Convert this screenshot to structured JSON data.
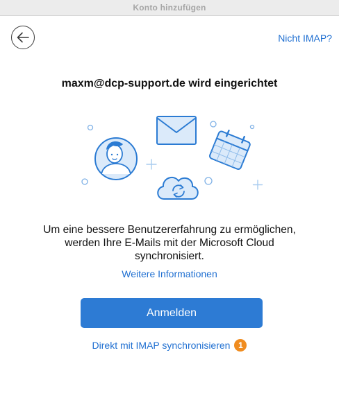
{
  "window": {
    "title": "Konto hinzufügen"
  },
  "header": {
    "back_icon": "arrow-left-icon",
    "not_imap_link": "Nicht IMAP?"
  },
  "main": {
    "heading": "maxm@dcp-support.de wird eingerichtet",
    "illustration_icons": [
      "person-avatar-icon",
      "envelope-icon",
      "calendar-icon",
      "cloud-sync-icon"
    ],
    "description_lines": [
      "Um eine bessere Benutzererfahrung zu ermöglichen,",
      "werden Ihre E-Mails mit der Microsoft Cloud",
      "synchronisiert."
    ],
    "more_info_link": "Weitere Informationen",
    "signin_button": "Anmelden",
    "imap_sync_link": "Direkt mit IMAP synchronisieren",
    "imap_badge": "1"
  },
  "colors": {
    "accent": "#2d7bd4",
    "link": "#1f6fd1",
    "badge": "#f08c1f",
    "illustration_stroke": "#2b7bd3",
    "illustration_fill": "#dbeafa"
  }
}
